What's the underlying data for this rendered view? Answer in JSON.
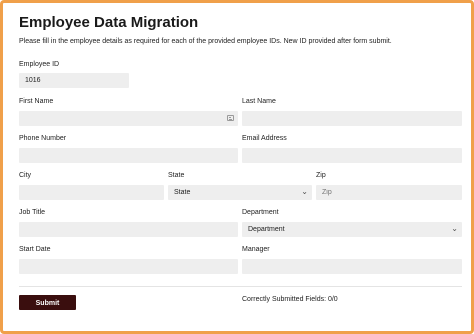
{
  "form": {
    "title": "Employee Data Migration",
    "subtitle": "Please fill in the employee details as required for each of the provided employee IDs. New ID provided after form submit.",
    "fields": {
      "employee_id": {
        "label": "Employee ID",
        "value": "1016"
      },
      "first_name": {
        "label": "First Name",
        "value": ""
      },
      "last_name": {
        "label": "Last Name",
        "value": ""
      },
      "phone": {
        "label": "Phone Number",
        "value": ""
      },
      "email": {
        "label": "Email Address",
        "value": ""
      },
      "city": {
        "label": "City",
        "value": ""
      },
      "state": {
        "label": "State",
        "selected": "State"
      },
      "zip": {
        "label": "Zip",
        "placeholder": "Zip",
        "value": ""
      },
      "job_title": {
        "label": "Job Title",
        "value": ""
      },
      "department": {
        "label": "Department",
        "selected": "Department"
      },
      "start_date": {
        "label": "Start Date",
        "value": ""
      },
      "manager": {
        "label": "Manager",
        "value": ""
      }
    },
    "submit_label": "Submit",
    "status_text": "Correctly Submitted Fields: 0/0"
  },
  "colors": {
    "frame_border": "#f0a04a",
    "submit_bg": "#3a0e0e",
    "input_bg": "#eeeeee"
  },
  "icons": {
    "autofill": "contact-card-icon",
    "dropdown": "chevron-down-icon"
  }
}
